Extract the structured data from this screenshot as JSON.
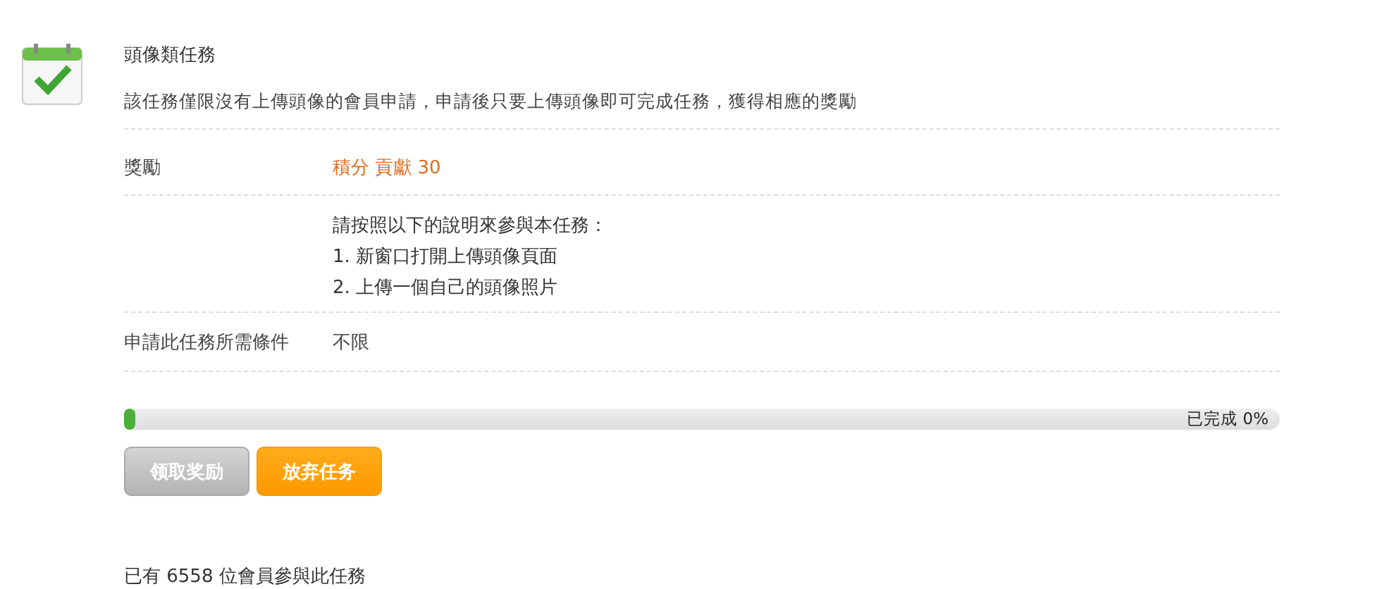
{
  "task": {
    "title": "頭像類任務",
    "description": "該任務僅限沒有上傳頭像的會員申請，申請後只要上傳頭像即可完成任務，獲得相應的獎勵"
  },
  "reward": {
    "label": "獎勵",
    "value": "積分 貢獻 30"
  },
  "instructions": {
    "heading": "請按照以下的說明來參與本任務：",
    "steps": [
      "1. 新窗口打開上傳頭像頁面",
      "2. 上傳一個自己的頭像照片"
    ]
  },
  "condition": {
    "label": "申請此任務所需條件",
    "value": "不限"
  },
  "progress": {
    "level": 0,
    "reading": "已完成 0%"
  },
  "buttons": [
    {
      "label": "领取奖励",
      "disabled": true
    },
    {
      "label": "放弃任务",
      "disabled": false
    }
  ],
  "participants": "已有 6558 位會員參與此任務"
}
